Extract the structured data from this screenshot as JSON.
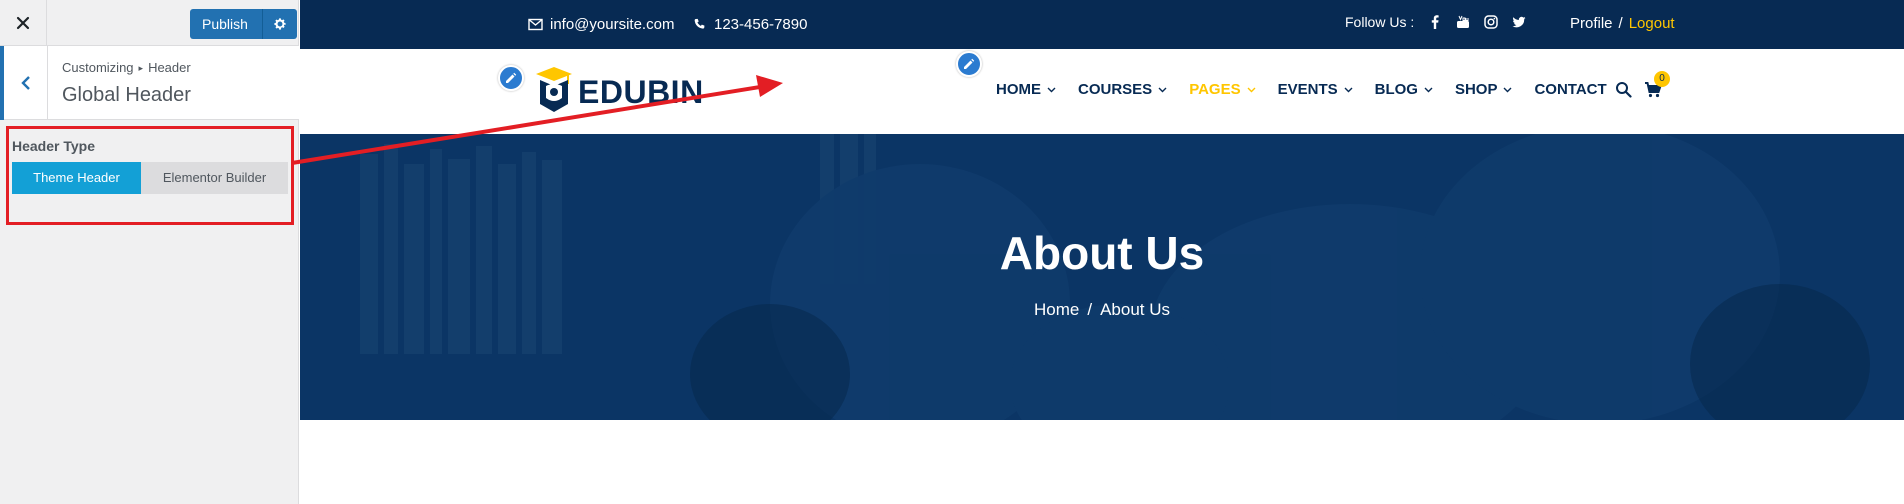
{
  "customizer": {
    "publish_label": "Publish",
    "breadcrumb_root": "Customizing",
    "breadcrumb_sep": "▸",
    "breadcrumb_section": "Header",
    "section_title": "Global Header",
    "control": {
      "label": "Header Type",
      "options": [
        "Theme Header",
        "Elementor Builder"
      ],
      "selected": "Theme Header"
    }
  },
  "site": {
    "topbar": {
      "email": "info@yoursite.com",
      "phone": "123-456-7890",
      "follow_label": "Follow Us :",
      "social": [
        "facebook-icon",
        "youtube-icon",
        "instagram-icon",
        "twitter-icon"
      ],
      "profile": "Profile",
      "separator": "/",
      "logout": "Logout"
    },
    "logo_text": "EDUBIN",
    "menu": [
      {
        "label": "HOME",
        "caret": true
      },
      {
        "label": "COURSES",
        "caret": true
      },
      {
        "label": "PAGES",
        "caret": true,
        "current": true
      },
      {
        "label": "EVENTS",
        "caret": true
      },
      {
        "label": "BLOG",
        "caret": true
      },
      {
        "label": "SHOP",
        "caret": true
      },
      {
        "label": "CONTACT",
        "caret": false
      }
    ],
    "cart_count": "0",
    "hero": {
      "title": "About Us",
      "crumb_home": "Home",
      "crumb_sep": "/",
      "crumb_current": "About Us"
    }
  },
  "colors": {
    "topbar_bg": "#072a53",
    "accent": "#ffc600",
    "customizer_blue": "#2271b1",
    "toggle_active": "#13a0d6",
    "highlight_red": "#e31e24"
  }
}
